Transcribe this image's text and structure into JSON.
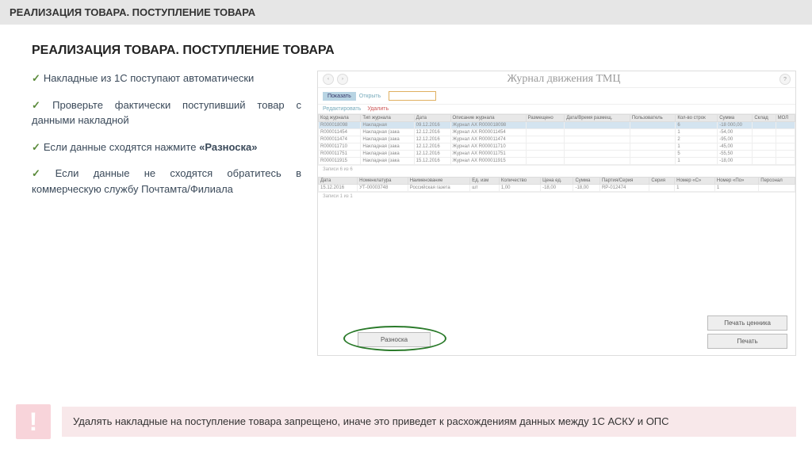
{
  "header_bar": "РЕАЛИЗАЦИЯ ТОВАРА. ПОСТУПЛЕНИЕ ТОВАРА",
  "content_title": "РЕАЛИЗАЦИЯ ТОВАРА. ПОСТУПЛЕНИЕ ТОВАРА",
  "bullets": [
    {
      "text": "Накладные из 1С поступают автоматически"
    },
    {
      "text": "Проверьте фактически поступивший товар с данными накладной"
    },
    {
      "pre": "Если данные сходятся нажмите ",
      "bold": "«Разноска»"
    },
    {
      "text": "Если данные не сходятся обратитесь в коммерческую службу Почтамта/Филиала"
    }
  ],
  "screenshot": {
    "title": "Журнал движения ТМЦ",
    "filter_show": "Показать",
    "filter_open": "Открыть",
    "action_edit": "Редактировать",
    "action_delete": "Удалить",
    "headers": [
      "Код журнала",
      "Тип журнала",
      "Дата",
      "Описание журнала",
      "Размещено",
      "Дата/Время размещ.",
      "Пользователь",
      "Кол-во строк",
      "Сумма",
      "Склад",
      "МОЛ"
    ],
    "rows": [
      {
        "id": "R000018098",
        "type": "Накладная",
        "date": "09.12.2016",
        "desc": "Журнал АХ R000018098",
        "priv": "",
        "dt": "",
        "user": "",
        "qty": "6",
        "sum": "-18 000,00",
        "sel": true
      },
      {
        "id": "R000011454",
        "type": "Накладная (зака",
        "date": "12.12.2016",
        "desc": "Журнал АХ R000011454",
        "priv": "",
        "dt": "",
        "user": "",
        "qty": "1",
        "sum": "-54,00"
      },
      {
        "id": "R000011474",
        "type": "Накладная (зака",
        "date": "12.12.2016",
        "desc": "Журнал АХ R000011474",
        "priv": "",
        "dt": "",
        "user": "",
        "qty": "2",
        "sum": "-95,00"
      },
      {
        "id": "R000011710",
        "type": "Накладная (зака",
        "date": "12.12.2016",
        "desc": "Журнал АХ R000011710",
        "priv": "",
        "dt": "",
        "user": "",
        "qty": "1",
        "sum": "-45,00"
      },
      {
        "id": "R000011751",
        "type": "Накладная (зака",
        "date": "12.12.2016",
        "desc": "Журнал АХ R000011751",
        "priv": "",
        "dt": "",
        "user": "",
        "qty": "5",
        "sum": "-55,50"
      },
      {
        "id": "R000011915",
        "type": "Накладная (зака",
        "date": "15.12.2016",
        "desc": "Журнал АХ R000011915",
        "priv": "",
        "dt": "",
        "user": "",
        "qty": "1",
        "sum": "-18,00"
      }
    ],
    "pager": "Записи 6 из 6",
    "detail_headers": [
      "Дата",
      "Номенклатура",
      "Наименование",
      "Ед. изм",
      "Количество",
      "Цена ед.",
      "Сумма",
      "Партия/Серия",
      "Серия",
      "Номер «С»",
      "Номер «По»",
      "Персонал"
    ],
    "detail_row": {
      "date": "15.12.2016",
      "nom": "УТ-00003748",
      "name": "Российская газета",
      "unit": "шт",
      "qty": "1,00",
      "price": "-18,00",
      "sum": "-18,00",
      "party": "RP-012474",
      "ser": "",
      "nc": "1",
      "np": "1",
      "pers": ""
    },
    "btn_raznoska": "Разноска",
    "btn_price_tag": "Печать ценника",
    "btn_print": "Печать"
  },
  "warning": "Удалять накладные на поступление товара запрещено, иначе это приведет к расхождениям данных между 1С АСКУ и ОПС"
}
